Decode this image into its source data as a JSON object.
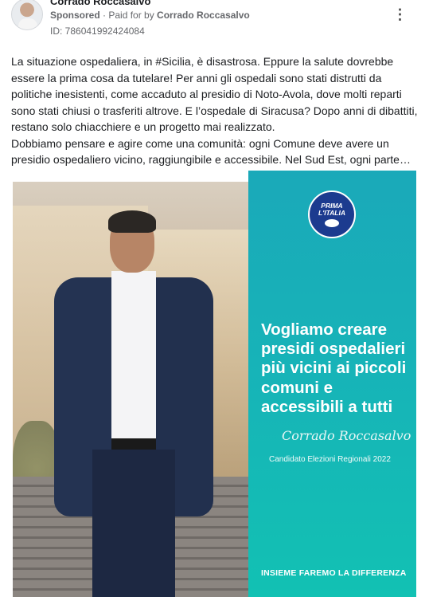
{
  "post": {
    "author": "Corrado Roccasalvo",
    "sponsored_label": "Sponsored",
    "separator": " · ",
    "paid_for_prefix": "Paid for by ",
    "paid_for_name": "Corrado Roccasalvo",
    "ad_id": "ID: 786041992424084",
    "more_icon": "more-dots-icon",
    "text_lines": [
      "La situazione ospedaliera, in #Sicilia, è disastrosa. Eppure la salute dovrebbe essere la prima cosa da tutelare! Per anni gli ospedali sono stati distrutti da politiche inesistenti, come accaduto al presidio di Noto-Avola, dove molti reparti sono stati chiusi o trasferiti altrove. E l’ospedale di Siracusa? Dopo anni di dibattiti, restano solo chiacchiere e un progetto mai realizzato.",
      "Dobbiamo pensare e agire come una comunità: ogni Comune deve avere un presidio ospedaliero vicino, raggiungibile e accessibile. Nel Sud Est, ogni parte…"
    ]
  },
  "ad_image": {
    "logo_line1": "PRIMA",
    "logo_line2": "L'ITALIA",
    "headline": "Vogliamo creare presidi ospedalieri più vicini ai piccoli comuni e accessibili a tutti",
    "signature": "Corrado Roccasalvo",
    "role": "Candidato Elezioni Regionali 2022",
    "tagline": "INSIEME FAREMO LA DIFFERENZA",
    "panel_color": "#17b3b8"
  }
}
